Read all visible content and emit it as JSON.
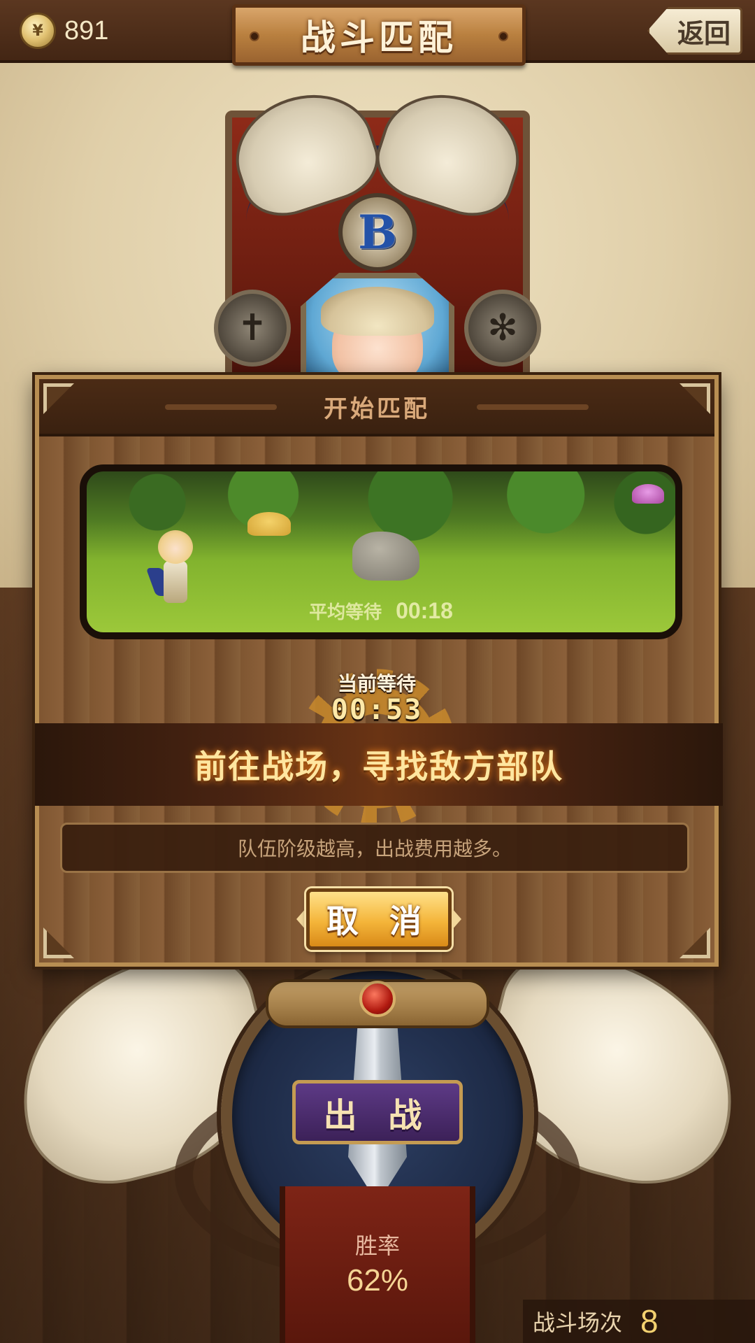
{
  "header": {
    "coins": "891",
    "title": "战斗匹配",
    "back_label": "返回"
  },
  "emblem": {
    "rank_letter": "B"
  },
  "dialog": {
    "title": "开始匹配",
    "average_wait_label": "平均等待",
    "average_wait_value": "00:18",
    "current_wait_label": "当前等待",
    "current_wait_value": "00:53",
    "status": "前往战场，寻找敌方部队",
    "tip": "队伍阶级越高，出战费用越多。",
    "cancel_label": "取 消"
  },
  "footer": {
    "sortie_label": "出 战",
    "win_rate_label": "胜率",
    "win_rate_value": "62%",
    "sessions_label": "战斗场次",
    "sessions_value": "8"
  },
  "icons": {
    "coin": "coin-icon",
    "back": "back-arrow-icon",
    "rank": "rank-badge-icon",
    "sword": "sword-icon"
  },
  "colors": {
    "accent_gold": "#f4b53a",
    "status_glow": "#ff8a1c",
    "rank_blue": "#2452a8",
    "ribbon_purple": "#5d3a86"
  }
}
